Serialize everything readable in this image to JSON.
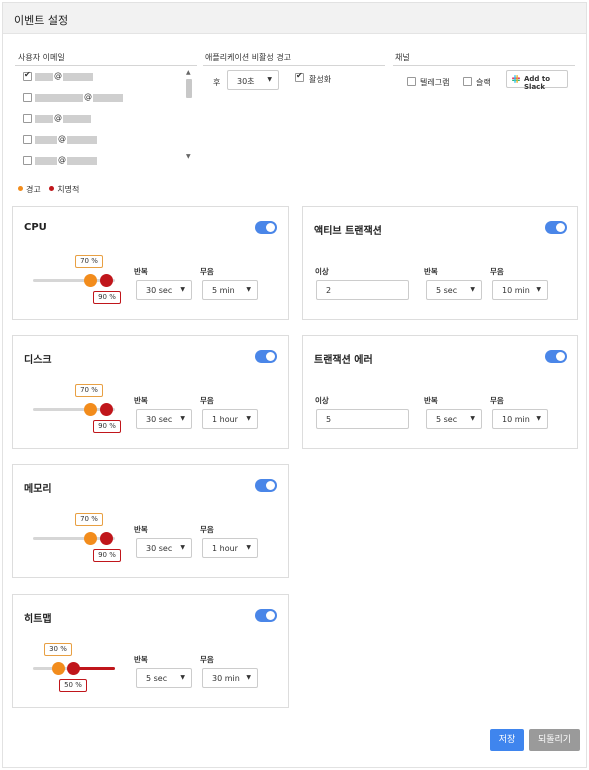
{
  "page_title": "이벤트 설정",
  "sections": {
    "user_email": "사용자 이메일",
    "app_inactivity": "애플리케이션 비활성 경고",
    "channel": "채널"
  },
  "emails": [
    {
      "at": "@",
      "checked": true
    },
    {
      "at": "@",
      "checked": false
    },
    {
      "at": "@",
      "checked": false
    },
    {
      "at": "@",
      "checked": false
    },
    {
      "at": "@",
      "checked": false
    }
  ],
  "inactivity": {
    "after_label": "후",
    "duration_value": "30초",
    "activate_label": "활성화",
    "activate_checked": true
  },
  "channels": {
    "telegram_label": "텔레그램",
    "slack_label": "슬랙",
    "add_to_slack": "Add to Slack"
  },
  "legend": {
    "warning": "경고",
    "critical": "치명적",
    "warning_color": "#f28c1c",
    "critical_color": "#c0161b"
  },
  "labels": {
    "repeat": "반복",
    "mute": "무음",
    "threshold": "이상"
  },
  "cards": {
    "cpu": {
      "title": "CPU",
      "enabled": true,
      "warn": "70 %",
      "crit": "90 %",
      "warn_value": 70,
      "crit_value": 90,
      "repeat": "30 sec",
      "mute": "5 min"
    },
    "disk": {
      "title": "디스크",
      "enabled": true,
      "warn": "70 %",
      "crit": "90 %",
      "warn_value": 70,
      "crit_value": 90,
      "repeat": "30 sec",
      "mute": "1 hour"
    },
    "memory": {
      "title": "메모리",
      "enabled": true,
      "warn": "70 %",
      "crit": "90 %",
      "warn_value": 70,
      "crit_value": 90,
      "repeat": "30 sec",
      "mute": "1 hour"
    },
    "heatmap": {
      "title": "히트맵",
      "enabled": true,
      "warn": "30 %",
      "crit": "50 %",
      "warn_value": 30,
      "crit_value": 50,
      "repeat": "5 sec",
      "mute": "30 min"
    },
    "active_tx": {
      "title": "액티브 트랜잭션",
      "enabled": true,
      "threshold": "2",
      "repeat": "5 sec",
      "mute": "10 min"
    },
    "tx_error": {
      "title": "트랜잭션 에러",
      "enabled": true,
      "threshold": "5",
      "repeat": "5 sec",
      "mute": "10 min"
    }
  },
  "buttons": {
    "save": "저장",
    "revert": "되돌리기"
  },
  "colors": {
    "accent": "#4a86e8",
    "save_button": "#3f85ee",
    "revert_button": "#9a9a9a"
  }
}
